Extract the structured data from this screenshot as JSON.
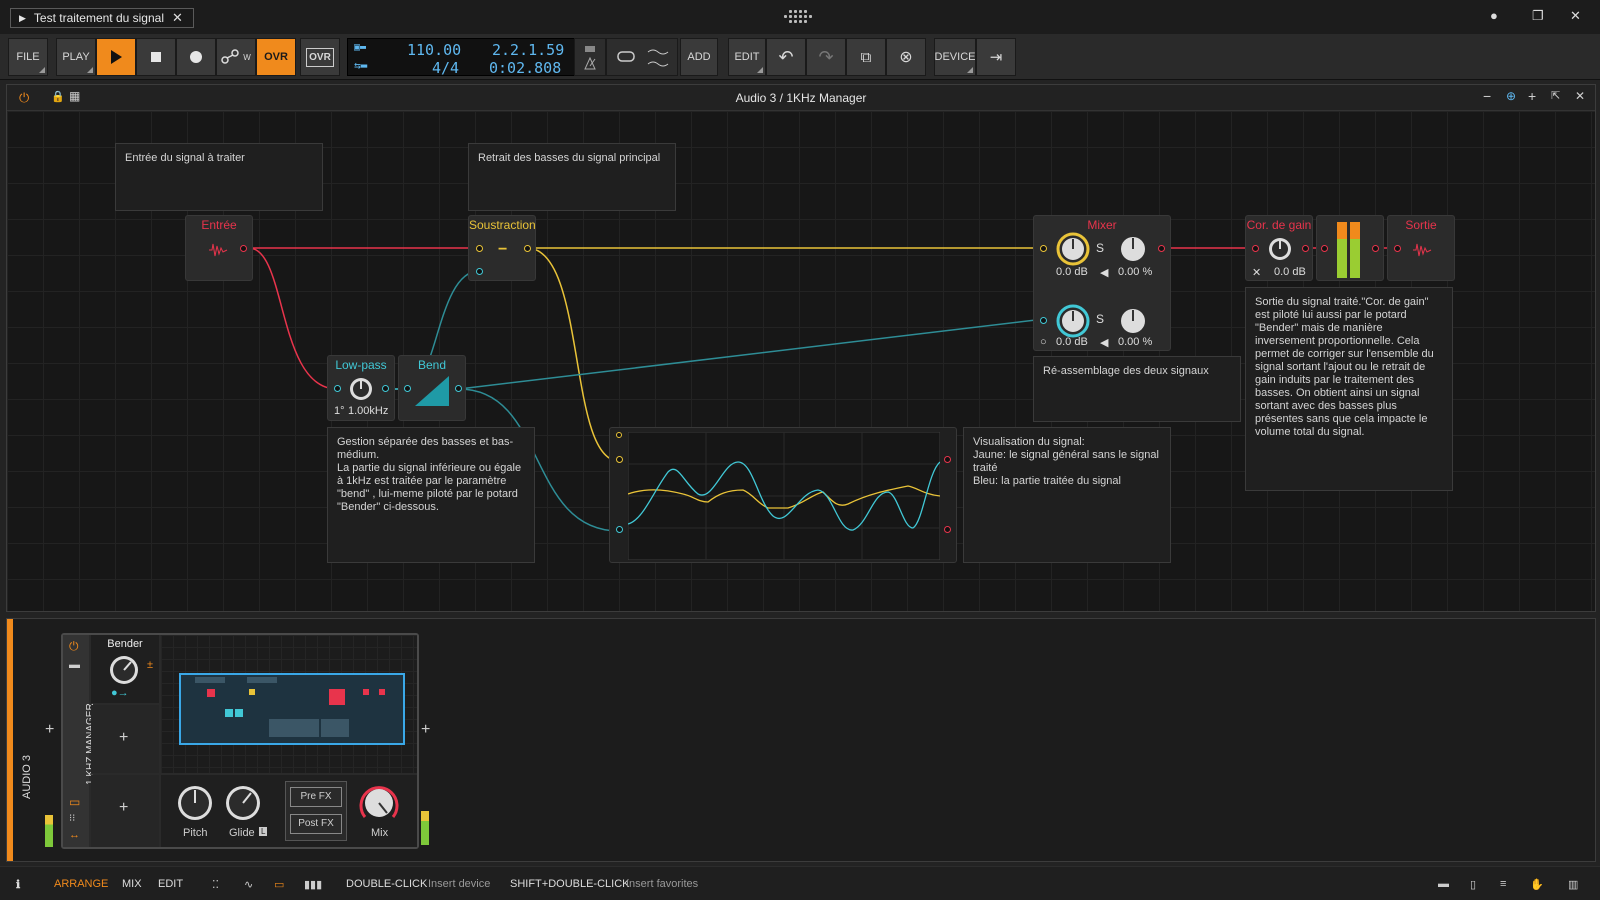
{
  "window": {
    "tab_title": "Test traitement du signal",
    "tab_close": "✕",
    "controls": [
      "●",
      "❐",
      "✕"
    ]
  },
  "toolbar": {
    "file": "FILE",
    "play": "PLAY",
    "ovr": "OVR",
    "ovr2": "OVR",
    "add": "ADD",
    "edit": "EDIT",
    "device": "DEVICE",
    "tempo": "110.00",
    "signature": "4/4",
    "position": "2.2.1.59",
    "time": "0:02.808",
    "automation_write": "W"
  },
  "panel": {
    "title": "Audio 3 / 1KHz Manager",
    "controls": [
      "−",
      "+"
    ]
  },
  "grid": {
    "note_entree": "Entrée du signal à traiter",
    "note_retrait": "Retrait des basses du signal principal",
    "note_gestion": "Gestion séparée des basses et bas-médium.\nLa partie du signal inférieure ou égale à 1kHz est traitée par le paramètre \"bend\" , lui-meme piloté par le potard \"Bender\" ci-dessous.",
    "note_visu": "Visualisation du signal:\nJaune: le signal général sans le signal traité\nBleu: la partie traitée du signal",
    "note_reassemblage": "Ré-assemblage des deux signaux",
    "note_sortie": "Sortie du signal traité.\"Cor. de gain\" est piloté lui aussi par le potard \"Bender\" mais de manière inversement proportionnelle. Cela permet de corriger sur l'ensemble du signal sortant l'ajout ou le retrait de gain  induits par le traitement des basses. On obtient ainsi un signal sortant avec des basses plus présentes sans que cela impacte  le volume total du signal.",
    "mod_entree": "Entrée",
    "mod_soustraction": "Soustraction",
    "mod_lowpass": "Low-pass",
    "lowpass_order": "1°",
    "lowpass_freq": "1.00kHz",
    "mod_bend": "Bend",
    "mod_mixer": "Mixer",
    "mixer_gain_1": "0.0 dB",
    "mixer_pct_1": "0.00 %",
    "mixer_gain_2": "0.0 dB",
    "mixer_pct_2": "0.00 %",
    "mixer_s": "S",
    "mod_cor_gain": "Cor. de gain",
    "cor_gain_value": "0.0 dB",
    "mod_sortie": "Sortie"
  },
  "chain": {
    "track_label": "AUDIO 3",
    "device_label": "1 KHZ MANAGER",
    "macro_name": "Bender",
    "pitch": "Pitch",
    "glide": "Glide",
    "glide_badge": "L",
    "pre_fx": "Pre FX",
    "post_fx": "Post FX",
    "mix": "Mix",
    "add_plus": "+"
  },
  "status": {
    "arrange": "ARRANGE",
    "mix": "MIX",
    "edit": "EDIT",
    "hint1_key": "DOUBLE-CLICK",
    "hint1_text": "Insert device",
    "hint2_key": "SHIFT+DOUBLE-CLICK",
    "hint2_text": "Insert favorites"
  },
  "colors": {
    "accent": "#f08a1c",
    "red": "#e8344c",
    "yellow": "#e9c338",
    "cyan": "#41c8d6"
  }
}
